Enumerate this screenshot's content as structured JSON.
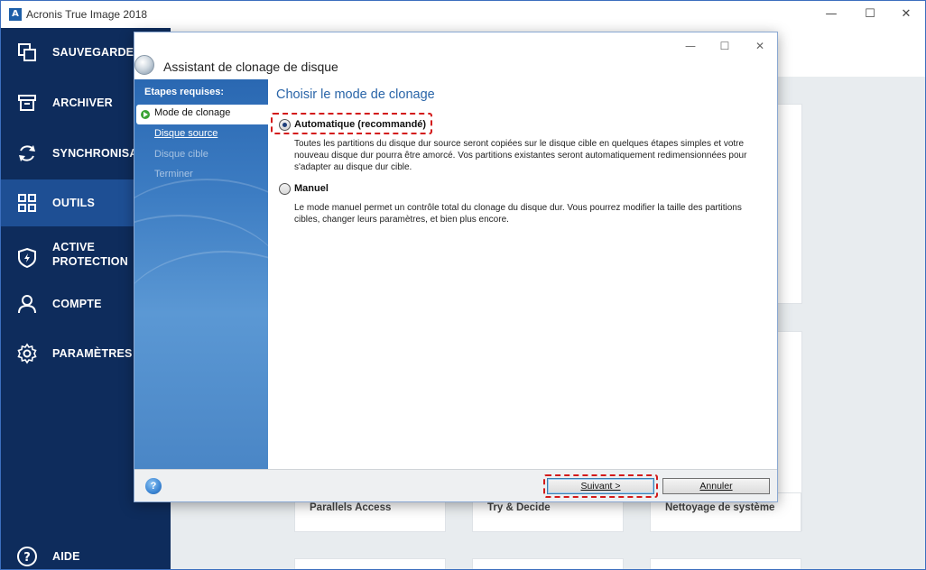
{
  "window": {
    "title": "Acronis True Image 2018",
    "controls": {
      "minimize": "—",
      "maximize": "☐",
      "close": "✕"
    }
  },
  "sidebar": {
    "items": [
      {
        "label": "SAUVEGARDE",
        "icon": "backup-copy-icon",
        "active": false
      },
      {
        "label": "ARCHIVER",
        "icon": "archive-box-icon",
        "active": false
      },
      {
        "label": "SYNCHRONISAT",
        "icon": "sync-icon",
        "active": false
      },
      {
        "label": "OUTILS",
        "icon": "tools-grid-icon",
        "active": true
      },
      {
        "label": "ACTIVE",
        "label2": "PROTECTION",
        "icon": "shield-icon",
        "active": false
      },
      {
        "label": "COMPTE",
        "icon": "user-icon",
        "active": false
      },
      {
        "label": "PARAMÈTRES",
        "icon": "gear-icon",
        "active": false
      }
    ],
    "help": {
      "label": "AIDE",
      "icon": "help-circle-icon"
    }
  },
  "tools": {
    "cards": [
      {
        "label": "Parallels Access"
      },
      {
        "label": "Try & Decide"
      },
      {
        "label": "Nettoyage de système"
      }
    ]
  },
  "dialog": {
    "title": "Assistant de clonage de disque",
    "controls": {
      "minimize": "—",
      "maximize": "☐",
      "close": "✕"
    },
    "steps": {
      "title": "Etapes requises:",
      "items": [
        {
          "label": "Mode de clonage",
          "state": "current"
        },
        {
          "label": "Disque source",
          "state": "link"
        },
        {
          "label": "Disque cible",
          "state": "disabled"
        },
        {
          "label": "Terminer",
          "state": "disabled"
        }
      ]
    },
    "heading": "Choisir le mode de clonage",
    "options": [
      {
        "label": "Automatique (recommandé)",
        "checked": true,
        "description": "Toutes les partitions du disque dur source seront copiées sur le disque cible en quelques étapes simples et votre nouveau disque dur pourra être amorcé. Vos partitions existantes seront automatiquement redimensionnées pour s'adapter au disque dur cible."
      },
      {
        "label": "Manuel",
        "checked": false,
        "description": "Le mode manuel permet un contrôle total du clonage du disque dur. Vous pourrez modifier la taille des partitions cibles, changer leurs paramètres, et bien plus encore."
      }
    ],
    "buttons": {
      "next": "Suivant >",
      "cancel": "Annuler"
    },
    "help_icon": "?"
  },
  "colors": {
    "sidebar": "#0e2c5c",
    "sidebar_active": "#1e4f94",
    "heading_blue": "#2a65a8",
    "highlight_red": "#d31a1a"
  }
}
